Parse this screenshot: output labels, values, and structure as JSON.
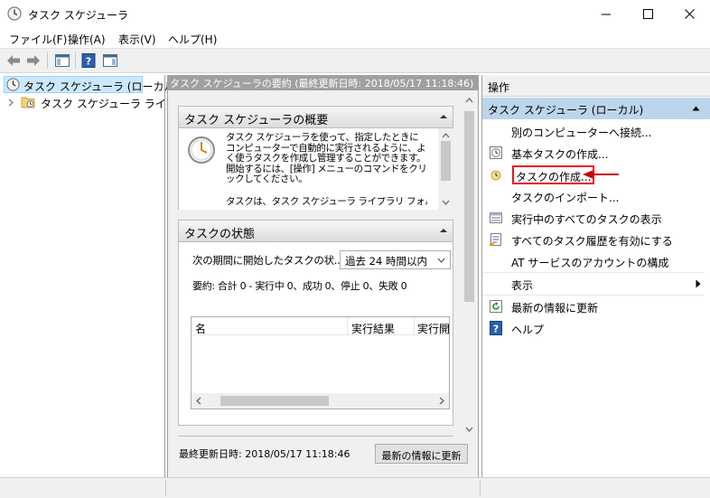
{
  "window": {
    "title": "タスク スケジューラ"
  },
  "menu": {
    "items": [
      "ファイル(F)",
      "操作(A)",
      "表示(V)",
      "ヘルプ(H)"
    ]
  },
  "tree": {
    "root_label": "タスク スケジューラ (ローカル)",
    "library_label": "タスク スケジューラ ライブラリ"
  },
  "center": {
    "header": "タスク スケジューラの要約 (最終更新日時: 2018/05/17 11:18:46)",
    "overview": {
      "title": "タスク スケジューラの概要",
      "text": "タスク スケジューラを使って、指定したときにコンピューターで自動的に実行されるように、よく使うタスクを作成し管理することができます。開始するには、[操作] メニューのコマンドをクリックしてください。",
      "text2": "タスクは、タスク スケジューラ ライブラリ フォルダ"
    },
    "status": {
      "title": "タスクの状態",
      "period_label": "次の期間に開始したタスクの状...",
      "period_value": "過去 24 時間以内",
      "summary": "要約: 合計 0 - 実行中 0、成功 0、停止 0、失敗 0",
      "columns": [
        "名",
        "実行結果",
        "実行開"
      ]
    },
    "footer": {
      "last_updated": "最終更新日時: 2018/05/17 11:18:46",
      "refresh_button": "最新の情報に更新"
    }
  },
  "actions": {
    "header": "操作",
    "section": "タスク スケジューラ (ローカル)",
    "items": [
      {
        "label": "別のコンピューターへ接続...",
        "icon": "none"
      },
      {
        "label": "基本タスクの作成...",
        "icon": "basic-task-icon"
      },
      {
        "label": "タスクの作成...",
        "icon": "create-task-icon"
      },
      {
        "label": "タスクのインポート...",
        "icon": "none"
      },
      {
        "label": "実行中のすべてのタスクの表示",
        "icon": "running-tasks-icon"
      },
      {
        "label": "すべてのタスク履歴を有効にする",
        "icon": "history-icon"
      },
      {
        "label": "AT サービスのアカウントの構成",
        "icon": "none"
      },
      {
        "label": "表示",
        "icon": "none"
      },
      {
        "label": "最新の情報に更新",
        "icon": "refresh-icon"
      },
      {
        "label": "ヘルプ",
        "icon": "help-icon"
      }
    ]
  },
  "colors": {
    "highlight_box": "#e81123",
    "annotation_arrow": "#c00000",
    "selection": "#cce8ff",
    "actions_section": "#bcd5ec"
  }
}
